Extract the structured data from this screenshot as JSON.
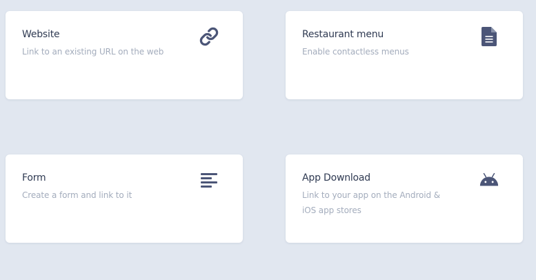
{
  "colors": {
    "background": "#e1e7f0",
    "card": "#ffffff",
    "title": "#2f3a52",
    "description": "#a3acbc",
    "icon": "#4b5577"
  },
  "cards": [
    {
      "title": "Website",
      "description": "Link to an existing URL on the web",
      "icon": "link-icon"
    },
    {
      "title": "Restaurant menu",
      "description": "Enable contactless menus",
      "icon": "document-icon"
    },
    {
      "title": "Form",
      "description": "Create a form and link to it",
      "icon": "align-left-icon"
    },
    {
      "title": "App Download",
      "description": "Link to your app on the Android & iOS app stores",
      "icon": "android-icon"
    }
  ]
}
